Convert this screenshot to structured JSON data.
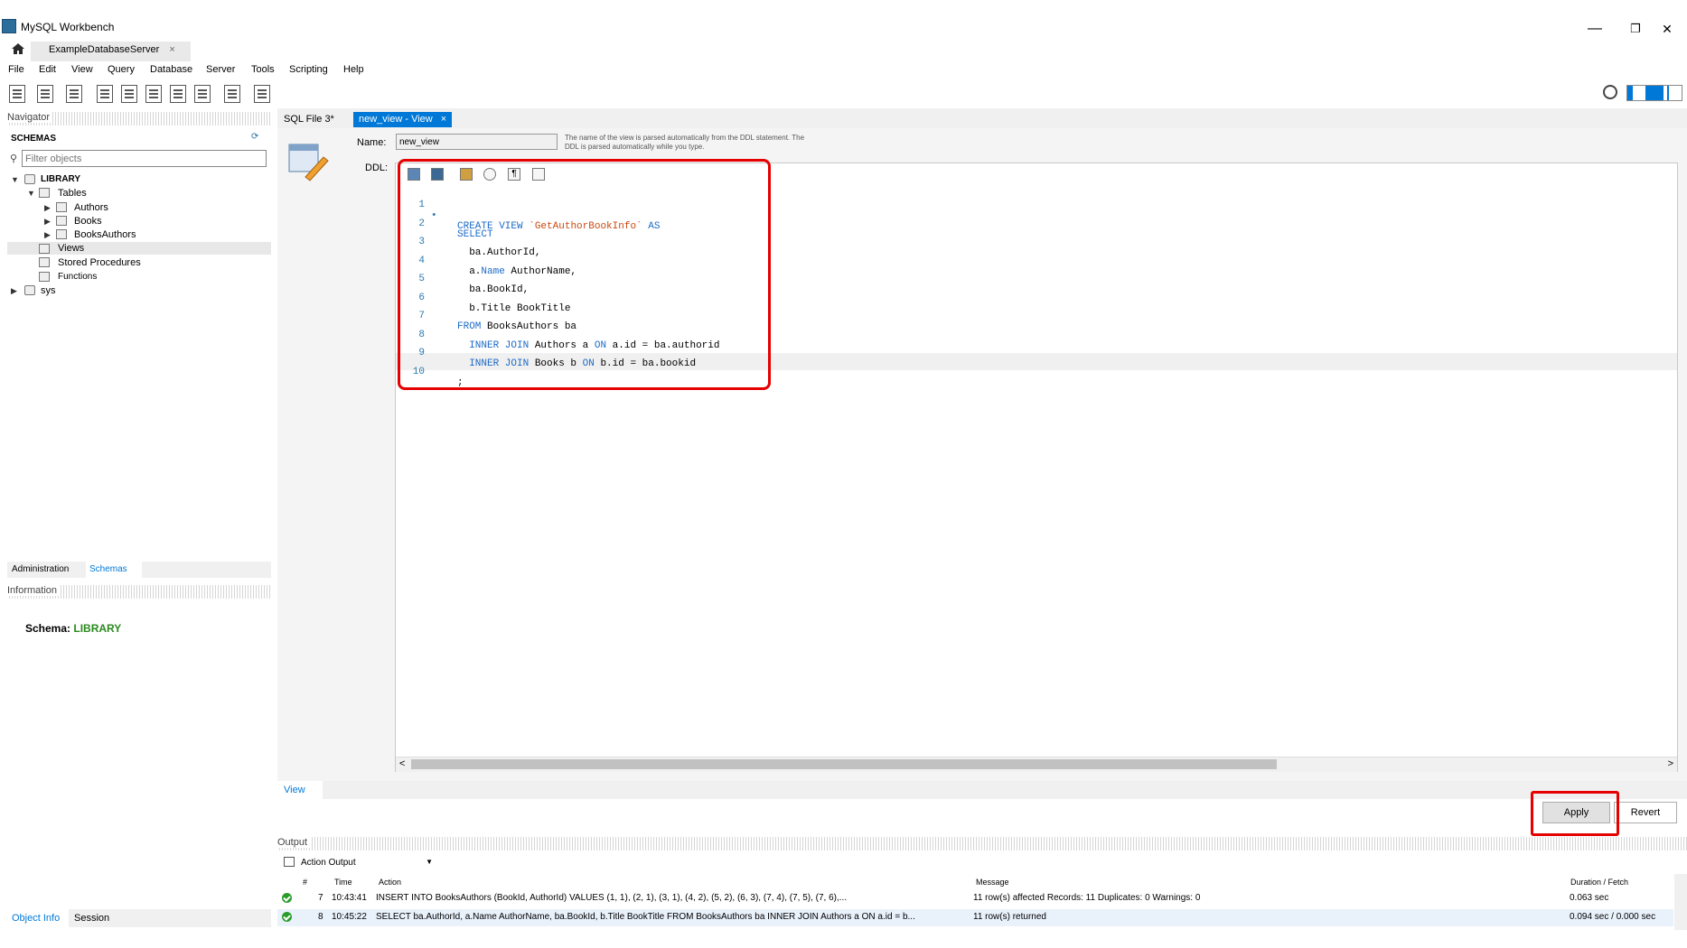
{
  "window": {
    "title": "MySQL Workbench",
    "minimize": "—",
    "restore": "❐",
    "close": "✕"
  },
  "connection_tab": {
    "label": "ExampleDatabaseServer",
    "close": "×"
  },
  "menu": [
    "File",
    "Edit",
    "View",
    "Query",
    "Database",
    "Server",
    "Tools",
    "Scripting",
    "Help"
  ],
  "navigator": {
    "header": "Navigator",
    "schemas_label": "SCHEMAS",
    "filter_placeholder": "Filter objects",
    "tree": {
      "library": "LIBRARY",
      "tables": "Tables",
      "authors": "Authors",
      "books": "Books",
      "booksauthors": "BooksAuthors",
      "views": "Views",
      "stored_procedures": "Stored Procedures",
      "functions": "Functions",
      "sys": "sys"
    },
    "bottom_tabs": [
      "Administration",
      "Schemas"
    ],
    "info_header": "Information",
    "schema_info_label": "Schema:",
    "schema_info_value": "LIBRARY",
    "left_bottom_tabs": [
      "Object Info",
      "Session"
    ]
  },
  "editor_tabs": [
    {
      "label": "SQL File 3*",
      "active": false
    },
    {
      "label": "new_view - View",
      "active": true,
      "close": "×"
    }
  ],
  "view_editor": {
    "name_label": "Name:",
    "name_value": "new_view",
    "name_hint": "The name of the view is parsed automatically from the DDL statement. The DDL is parsed automatically while you type.",
    "ddl_label": "DDL:",
    "code_lines": [
      {
        "n": "1",
        "marker": "•"
      },
      {
        "n": "2"
      },
      {
        "n": "3"
      },
      {
        "n": "4"
      },
      {
        "n": "5"
      },
      {
        "n": "6"
      },
      {
        "n": "7"
      },
      {
        "n": "8"
      },
      {
        "n": "9"
      },
      {
        "n": "10"
      }
    ],
    "code": {
      "l1_kw1": "CREATE VIEW",
      "l1_str": "`GetAuthorBookInfo`",
      "l1_kw2": "AS",
      "l2_kw": "SELECT",
      "l3": "  ba.AuthorId,",
      "l4_a": "  a.",
      "l4_kw": "Name",
      "l4_b": " AuthorName,",
      "l5": "  ba.BookId,",
      "l6": "  b.Title BookTitle",
      "l7_kw": "FROM",
      "l7_b": " BooksAuthors ba",
      "l8_kw1": "  INNER JOIN",
      "l8_b": " Authors a ",
      "l8_kw2": "ON",
      "l8_c": " a.id = ba.authorid",
      "l9_kw1": "  INNER JOIN",
      "l9_b": " Books b ",
      "l9_kw2": "ON",
      "l9_c": " b.id = ba.bookid",
      "l10": ";"
    },
    "scroll_left": "<",
    "scroll_right": ">",
    "subtab": "View",
    "apply_label": "Apply",
    "revert_label": "Revert"
  },
  "output": {
    "header": "Output",
    "select_value": "Action Output",
    "columns": [
      "#",
      "Time",
      "Action",
      "Message",
      "Duration / Fetch"
    ],
    "rows": [
      {
        "num": "7",
        "time": "10:43:41",
        "action": "INSERT INTO BooksAuthors   (BookId, AuthorId) VALUES   (1, 1),   (2, 1),   (3, 1),   (4, 2),   (5, 2),   (6, 3),   (7, 4),   (7, 5),   (7, 6),...",
        "message": "11 row(s) affected Records: 11  Duplicates: 0  Warnings: 0",
        "duration": "0.063 sec"
      },
      {
        "num": "8",
        "time": "10:45:22",
        "action": "SELECT  ba.AuthorId,  a.Name AuthorName,  ba.BookId,  b.Title BookTitle FROM BooksAuthors ba   INNER JOIN Authors a ON a.id = b...",
        "message": "11 row(s) returned",
        "duration": "0.094 sec / 0.000 sec"
      }
    ]
  },
  "colors": {
    "accent": "#0078d7",
    "highlight_box": "#e60000",
    "keyword": "#1c6bc7",
    "string": "#c94a10",
    "schema_name": "#2a8a1e"
  }
}
